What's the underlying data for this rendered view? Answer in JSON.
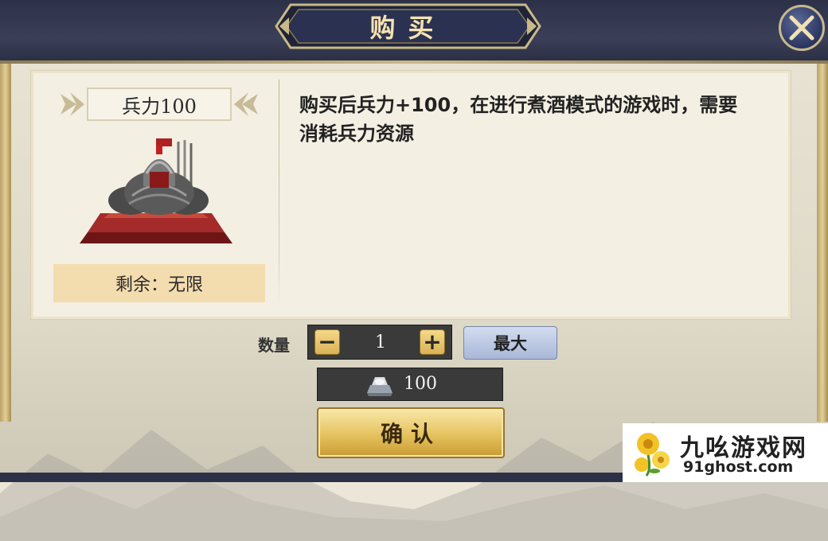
{
  "header": {
    "title": "购买",
    "close_icon": "close-x-icon"
  },
  "item": {
    "name": "兵力100",
    "image": "armored-soldier-bust-on-pedestal",
    "remaining": "剩余：无限",
    "description": "购买后兵力+100，在进行煮酒模式的游戏时，需要消耗兵力资源"
  },
  "quantity": {
    "label": "数量",
    "value": "1",
    "minus_label": "−",
    "plus_label": "+",
    "max_label": "最大"
  },
  "cost": {
    "icon": "silver-ingot-icon",
    "value": "100"
  },
  "confirm_label": "确认",
  "watermark": {
    "name": "九吆游戏网",
    "url": "91ghost.com"
  },
  "colors": {
    "header_bg": "#2c3148",
    "title_text": "#f4e2b0",
    "confirm_gold": "#e6c25e",
    "max_button": "#a9b8d8",
    "panel_bg": "#f4efe3"
  }
}
